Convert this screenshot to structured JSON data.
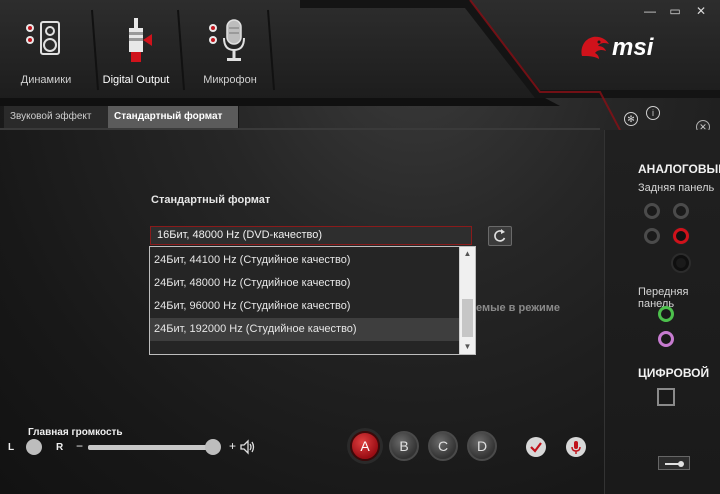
{
  "window_controls": {
    "minimize": "—",
    "restore": "▭",
    "close": "✕"
  },
  "devices": [
    {
      "label": "Динамики",
      "icon": "speaker-icon"
    },
    {
      "label": "Digital Output",
      "icon": "digital-output-plug-icon"
    },
    {
      "label": "Микрофон",
      "icon": "microphone-icon"
    }
  ],
  "brand": {
    "text": "msi",
    "accent": "#d0121b"
  },
  "tabs": [
    {
      "label": "Звуковой эффект"
    },
    {
      "label": "Стандартный формат"
    }
  ],
  "default_format": {
    "heading": "Стандартный формат",
    "selected": "16Бит, 48000 Hz (DVD-качество)",
    "options": [
      "24Бит, 44100 Hz (Студийное качество)",
      "24Бит, 48000 Hz (Студийное качество)",
      "24Бит, 96000 Hz (Студийное качество)",
      "24Бит, 192000 Hz (Студийное качество)"
    ],
    "partial_text": "емые в режиме"
  },
  "right_panel": {
    "analog_heading": "АНАЛОГОВЫЙ",
    "rear_panel": "Задняя панель",
    "front_panel": "Передняя панель",
    "digital_heading": "ЦИФРОВОЙ"
  },
  "volume": {
    "label": "Главная громкость",
    "left": "L",
    "right": "R",
    "minus": "−",
    "plus": "+",
    "level": 0.95
  },
  "presets": [
    "A",
    "B",
    "C",
    "D"
  ],
  "colors": {
    "accent": "#d0121b",
    "background": "#1c1c1c"
  }
}
